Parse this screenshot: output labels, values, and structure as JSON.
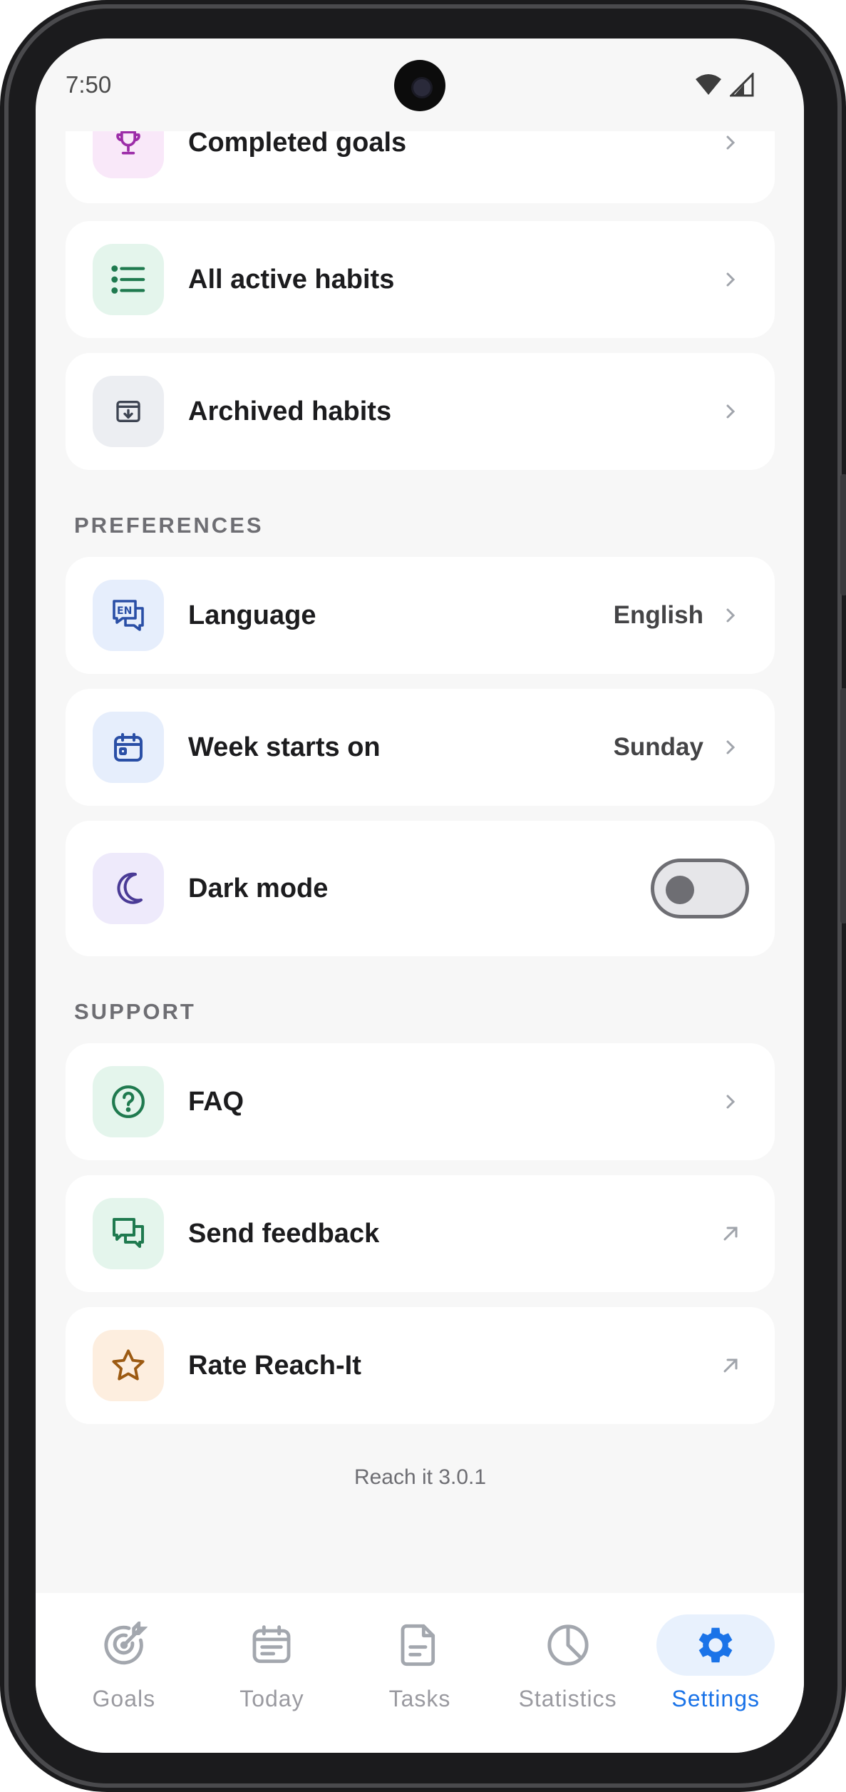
{
  "status": {
    "time": "7:50"
  },
  "top_items": [
    {
      "label": "Completed goals",
      "icon": "trophy-icon"
    },
    {
      "label": "All active habits",
      "icon": "list-icon"
    },
    {
      "label": "Archived habits",
      "icon": "archive-icon"
    }
  ],
  "preferences": {
    "title": "PREFERENCES",
    "language": {
      "label": "Language",
      "value": "English",
      "icon": "language-icon"
    },
    "week_start": {
      "label": "Week starts on",
      "value": "Sunday",
      "icon": "calendar-icon"
    },
    "dark_mode": {
      "label": "Dark mode",
      "enabled": false,
      "icon": "moon-icon"
    }
  },
  "support": {
    "title": "SUPPORT",
    "faq": {
      "label": "FAQ",
      "icon": "question-icon"
    },
    "feedback": {
      "label": "Send feedback",
      "icon": "chat-icon"
    },
    "rate": {
      "label": "Rate Reach-It",
      "icon": "star-icon"
    }
  },
  "version": "Reach it 3.0.1",
  "nav": [
    {
      "label": "Goals",
      "icon": "target-icon",
      "active": false
    },
    {
      "label": "Today",
      "icon": "today-icon",
      "active": false
    },
    {
      "label": "Tasks",
      "icon": "document-icon",
      "active": false
    },
    {
      "label": "Statistics",
      "icon": "pie-chart-icon",
      "active": false
    },
    {
      "label": "Settings",
      "icon": "gear-icon",
      "active": true
    }
  ],
  "colors": {
    "accent": "#1a73e8",
    "trophy_bg": "#f9e8f9",
    "trophy_fg": "#9c2ca8",
    "green_bg": "#e4f5ec",
    "green_fg": "#1f7a4f",
    "gray_bg": "#eceef2",
    "gray_fg": "#3d4452",
    "blue_bg": "#e6eefc",
    "blue_fg": "#2a4fa6",
    "purple_bg": "#eeeafb",
    "purple_fg": "#4a3b96",
    "orange_bg": "#fdeedf",
    "orange_fg": "#9c5a12"
  }
}
